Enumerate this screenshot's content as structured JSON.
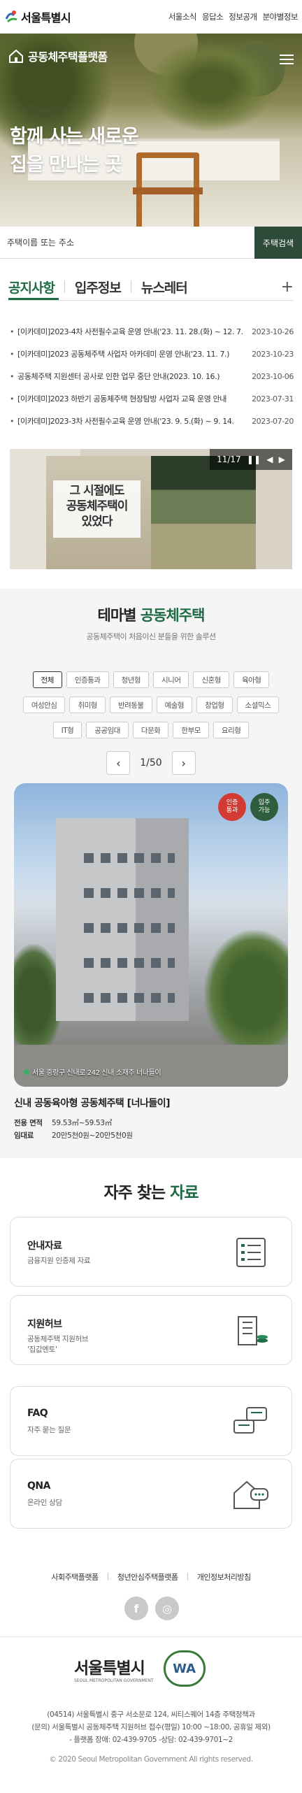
{
  "topbar": {
    "logo_text": "서울특별시",
    "nav": [
      "서울소식",
      "응답소",
      "정보공개",
      "분야별정보"
    ]
  },
  "hero": {
    "brand": "공동체주택플랫폼",
    "title_line1": "함께 사는 새로운",
    "title_line2": "집을 만나는 곳"
  },
  "search": {
    "placeholder": "주택이름 또는 주소",
    "button": "주택검색"
  },
  "notice_tabs": [
    "공지사항",
    "입주정보",
    "뉴스레터"
  ],
  "notices": [
    {
      "title": "[이카데미]2023-4차 사전필수교육 운영 안내('23. 11. 28.(화) ~ 12. 7.",
      "date": "2023-10-26"
    },
    {
      "title": "[이카데미]2023 공동체주택 사업자 아카데미 운영 안내('23. 11. 7.)",
      "date": "2023-10-23"
    },
    {
      "title": "공동체주택 지원센터 공사로 인한 업무 중단 안내(2023. 10. 16.)",
      "date": "2023-10-06"
    },
    {
      "title": "[이카데미]2023 하반기 공동체주택 현장탐방 사업자 교육 운영 안내",
      "date": "2023-07-31"
    },
    {
      "title": "[이카데미]2023-3차 사전필수교육 운영 안내('23. 9. 5.(화) ~ 9. 14.",
      "date": "2023-07-20"
    }
  ],
  "banner": {
    "text_line1": "그 시절에도",
    "text_line2": "공동체주택이",
    "text_line3": "있었다",
    "pager": "11/17"
  },
  "theme": {
    "title_prefix": "테마별 ",
    "title_accent": "공동체주택",
    "subtitle": "공동체주택이 처음이신 분들을 위한 솔루션",
    "chips_row1": [
      "전체",
      "인증통과",
      "청년형",
      "시니어",
      "신혼형",
      "육아형"
    ],
    "chips_row2": [
      "여성안심",
      "취미형",
      "반려동물",
      "예술형",
      "창업형",
      "소셜믹스"
    ],
    "chips_row3": [
      "IT형",
      "공공임대",
      "다문화",
      "한부모",
      "요리형"
    ],
    "pager": "1/50"
  },
  "house": {
    "badge1_line1": "인증",
    "badge1_line2": "통과",
    "badge2_line1": "입주",
    "badge2_line2": "가능",
    "caption": "서울 중랑구 신내로 242 신내 소재주 너나들이",
    "name": "신내 공동육아형 공동체주택 [너나들이]",
    "area_label": "전용 면적",
    "area_value": "59.53㎡~59.53㎡",
    "rent_label": "임대료",
    "rent_value": "20만5천0원~20만5천0원"
  },
  "faq": {
    "title_prefix": "자주 찾는 ",
    "title_accent": "자료",
    "cards": [
      {
        "title": "안내자료",
        "desc": "금융지원 인증제 자료",
        "desc2": "",
        "icon": "document-list-icon"
      },
      {
        "title": "지원허브",
        "desc": "공동체주택 지원허브",
        "desc2": "'집값멘토'",
        "icon": "building-coin-icon"
      },
      {
        "title": "FAQ",
        "desc": "자주 묻는 질문",
        "desc2": "",
        "icon": "chat-bubbles-icon"
      },
      {
        "title": "QNA",
        "desc": "온라인 상담",
        "desc2": "",
        "icon": "house-chat-icon"
      }
    ]
  },
  "footer": {
    "links": [
      "사회주택플랫폼",
      "청년안심주택플랫폼",
      "개인정보처리방침"
    ],
    "logo_text": "서울특별시",
    "logo_sub": "SEOUL METROPOLITAN GOVERNMENT",
    "wa_text": "WA",
    "address1": "(04514) 서울특별시 중구 서소문로 124, 씨티스퀘어 14층 주택정책과",
    "address2": "(문의) 서울특별시 공동체주택 지원허브 접수(평일) 10:00 ~18:00, 공휴일 제외)",
    "address3": "- 플랫폼 장애: 02-439-9705   -상담: 02-439-9701~2",
    "copyright": "© 2020 Seoul Metropolitan Government All rights reserved."
  }
}
